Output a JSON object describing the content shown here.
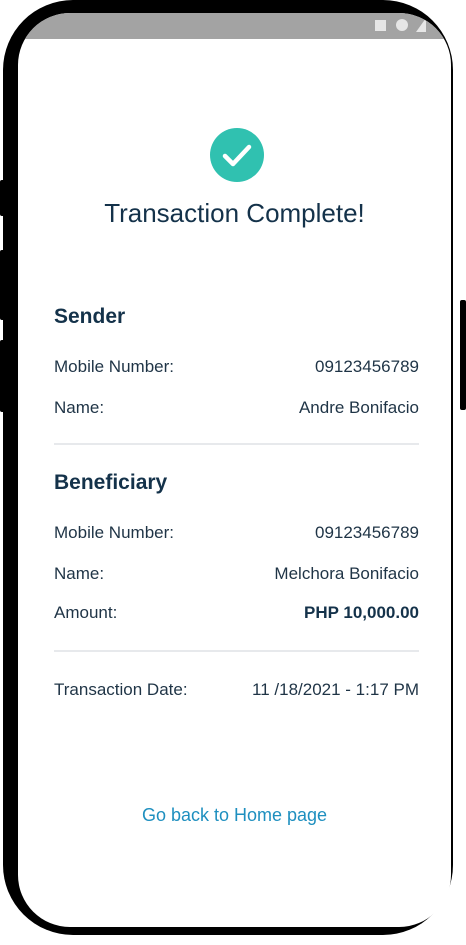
{
  "header": {
    "title": "Transaction Complete!"
  },
  "sender": {
    "heading": "Sender",
    "mobile_label": "Mobile Number:",
    "mobile_value": "09123456789",
    "name_label": "Name:",
    "name_value": "Andre Bonifacio"
  },
  "beneficiary": {
    "heading": "Beneficiary",
    "mobile_label": "Mobile Number:",
    "mobile_value": "09123456789",
    "name_label": "Name:",
    "name_value": "Melchora Bonifacio",
    "amount_label": "Amount:",
    "amount_value": "PHP 10,000.00"
  },
  "transaction": {
    "date_label": "Transaction Date:",
    "date_value": "11 /18/2021 - 1:17 PM"
  },
  "actions": {
    "home_link": "Go back to Home page"
  },
  "colors": {
    "accent": "#30c1b0",
    "link": "#1e8fbf",
    "heading": "#14324a",
    "status_bar": "#a3a3a3"
  },
  "icons": {
    "status": [
      "square-icon",
      "circle-icon",
      "triangle-icon"
    ],
    "success": "checkmark-icon"
  }
}
